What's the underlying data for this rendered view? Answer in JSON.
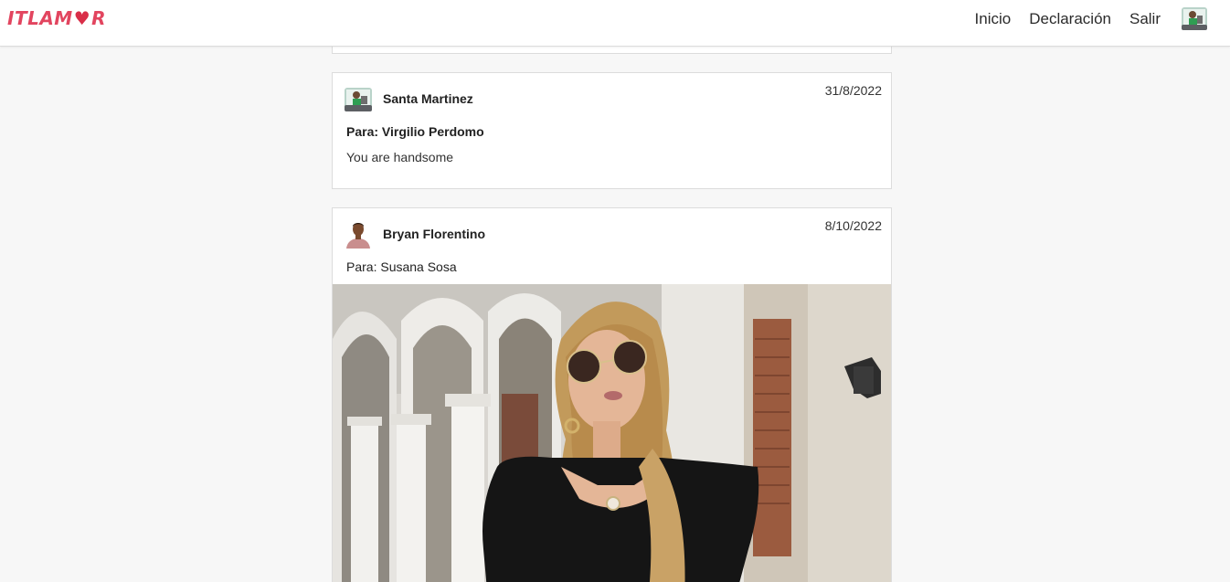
{
  "brand": {
    "text_left": "ITLAM",
    "text_right": "R",
    "heart": "♥",
    "color": "#e2455f"
  },
  "nav": {
    "links": [
      "Inicio",
      "Declaración",
      "Salir"
    ],
    "user_avatar": "user-avatar-icon"
  },
  "posts": [
    {
      "author": "Santa Martinez",
      "date": "31/8/2022",
      "to": "Para: Virgilio Perdomo",
      "message": "You are handsome",
      "avatar": "laptop-avatar-icon"
    },
    {
      "author": "Bryan Florentino",
      "date": "8/10/2022",
      "to": "Para: Susana Sosa",
      "image": "woman-sunglasses-photo",
      "avatar": "man-avatar-icon"
    }
  ]
}
